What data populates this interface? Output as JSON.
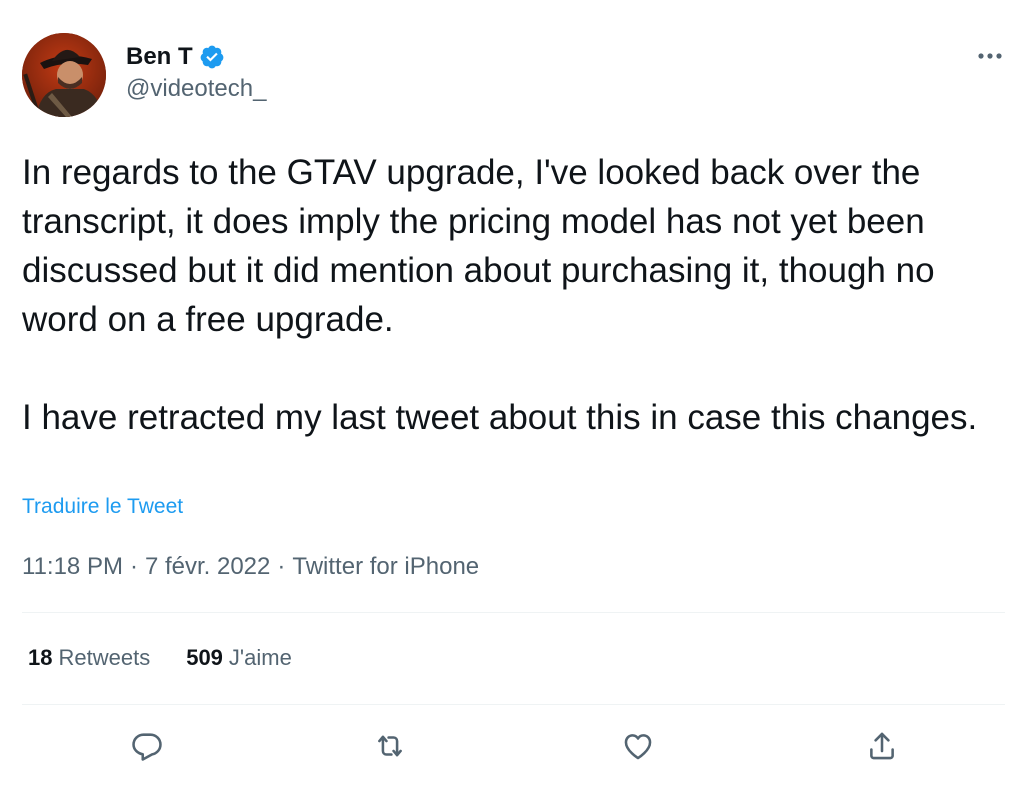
{
  "author": {
    "display_name": "Ben T",
    "handle": "@videotech_",
    "verified": true,
    "avatar": "profile-photo-avatar"
  },
  "tweet": {
    "text": "In regards to the GTAV upgrade, I've looked back over the transcript, it does imply the pricing model has not yet been discussed but it did mention about purchasing it, though no word on a free upgrade.\n\nI have retracted my last tweet about this in case this changes.",
    "translate_label": "Traduire le Tweet",
    "time": "11:18 PM",
    "date": "7 févr. 2022",
    "separator": "·",
    "source": "Twitter for iPhone"
  },
  "stats": {
    "retweets_count": "18",
    "retweets_label": "Retweets",
    "likes_count": "509",
    "likes_label": "J'aime"
  },
  "actions": [
    {
      "icon": "reply-icon"
    },
    {
      "icon": "retweet-icon"
    },
    {
      "icon": "like-icon"
    },
    {
      "icon": "share-icon"
    }
  ],
  "colors": {
    "text": "#0f1419",
    "secondary": "#536471",
    "link": "#1d9bf0",
    "divider": "#eff3f4",
    "verified": "#1d9bf0"
  }
}
